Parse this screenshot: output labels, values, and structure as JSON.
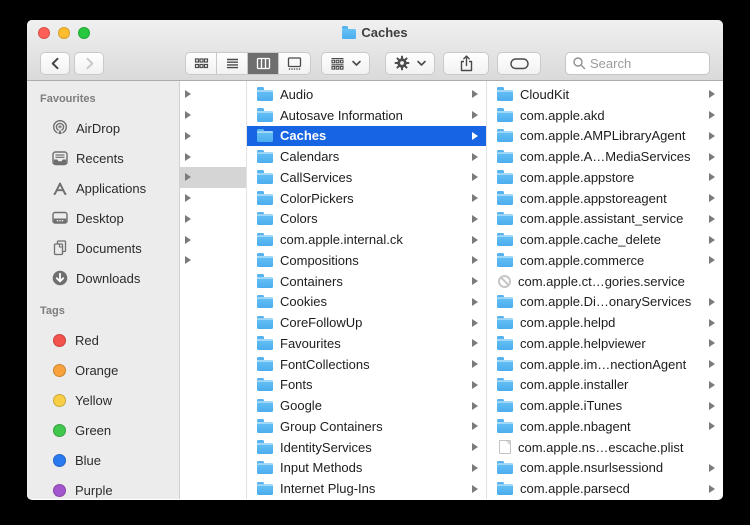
{
  "window": {
    "title": "Caches"
  },
  "toolbar": {
    "back_icon": "chevron-left-icon",
    "forward_icon": "chevron-right-icon",
    "view_modes": [
      "icon-view",
      "list-view",
      "column-view",
      "gallery-view"
    ],
    "view_selected": "column-view",
    "group_icon": "group-by-icon",
    "action_icon": "gear-icon",
    "share_icon": "share-icon",
    "tag_icon": "tag-icon",
    "search": {
      "icon": "search-icon",
      "placeholder": "Search",
      "value": ""
    }
  },
  "sidebar": {
    "sections": [
      {
        "label": "Favourites",
        "items": [
          {
            "label": "AirDrop",
            "icon": "airdrop-icon"
          },
          {
            "label": "Recents",
            "icon": "recents-icon"
          },
          {
            "label": "Applications",
            "icon": "applications-icon"
          },
          {
            "label": "Desktop",
            "icon": "desktop-icon"
          },
          {
            "label": "Documents",
            "icon": "documents-icon"
          },
          {
            "label": "Downloads",
            "icon": "downloads-icon"
          }
        ]
      },
      {
        "label": "Tags",
        "items": [
          {
            "label": "Red",
            "color": "#f2544d"
          },
          {
            "label": "Orange",
            "color": "#f7a23c"
          },
          {
            "label": "Yellow",
            "color": "#f7ce46"
          },
          {
            "label": "Green",
            "color": "#41c64e"
          },
          {
            "label": "Blue",
            "color": "#2a7aef"
          },
          {
            "label": "Purple",
            "color": "#a456cf"
          }
        ]
      }
    ]
  },
  "columns": {
    "parent_strip": {
      "arrow_rows": 9,
      "selected_index": 4
    },
    "library": {
      "selected_index": 2,
      "items": [
        "Audio",
        "Autosave Information",
        "Caches",
        "Calendars",
        "CallServices",
        "ColorPickers",
        "Colors",
        "com.apple.internal.ck",
        "Compositions",
        "Containers",
        "Cookies",
        "CoreFollowUp",
        "Favourites",
        "FontCollections",
        "Fonts",
        "Google",
        "Group Containers",
        "IdentityServices",
        "Input Methods",
        "Internet Plug-Ins"
      ]
    },
    "caches": {
      "items": [
        {
          "label": "CloudKit",
          "icon": "folder-icon",
          "chevron": true
        },
        {
          "label": "com.apple.akd",
          "icon": "folder-icon",
          "chevron": true
        },
        {
          "label": "com.apple.AMPLibraryAgent",
          "icon": "folder-icon",
          "chevron": true
        },
        {
          "label": "com.apple.A…MediaServices",
          "icon": "folder-icon",
          "chevron": true
        },
        {
          "label": "com.apple.appstore",
          "icon": "folder-icon",
          "chevron": true
        },
        {
          "label": "com.apple.appstoreagent",
          "icon": "folder-icon",
          "chevron": true
        },
        {
          "label": "com.apple.assistant_service",
          "icon": "folder-icon",
          "chevron": true
        },
        {
          "label": "com.apple.cache_delete",
          "icon": "folder-icon",
          "chevron": true
        },
        {
          "label": "com.apple.commerce",
          "icon": "folder-icon",
          "chevron": true
        },
        {
          "label": "com.apple.ct…gories.service",
          "icon": "restricted-icon",
          "chevron": false
        },
        {
          "label": "com.apple.Di…onaryServices",
          "icon": "folder-icon",
          "chevron": true
        },
        {
          "label": "com.apple.helpd",
          "icon": "folder-icon",
          "chevron": true
        },
        {
          "label": "com.apple.helpviewer",
          "icon": "folder-icon",
          "chevron": true
        },
        {
          "label": "com.apple.im…nectionAgent",
          "icon": "folder-icon",
          "chevron": true
        },
        {
          "label": "com.apple.installer",
          "icon": "folder-icon",
          "chevron": true
        },
        {
          "label": "com.apple.iTunes",
          "icon": "folder-icon",
          "chevron": true
        },
        {
          "label": "com.apple.nbagent",
          "icon": "folder-icon",
          "chevron": true
        },
        {
          "label": "com.apple.ns…escache.plist",
          "icon": "file-icon",
          "chevron": false
        },
        {
          "label": "com.apple.nsurlsessiond",
          "icon": "folder-icon",
          "chevron": true
        },
        {
          "label": "com.apple.parsecd",
          "icon": "folder-icon",
          "chevron": true
        }
      ]
    }
  },
  "colors": {
    "selection_blue": "#1765e3",
    "folder_blue": "#56b3ee",
    "traffic_red": "#ff5f57",
    "traffic_yellow": "#febc2e",
    "traffic_green": "#28c840"
  }
}
